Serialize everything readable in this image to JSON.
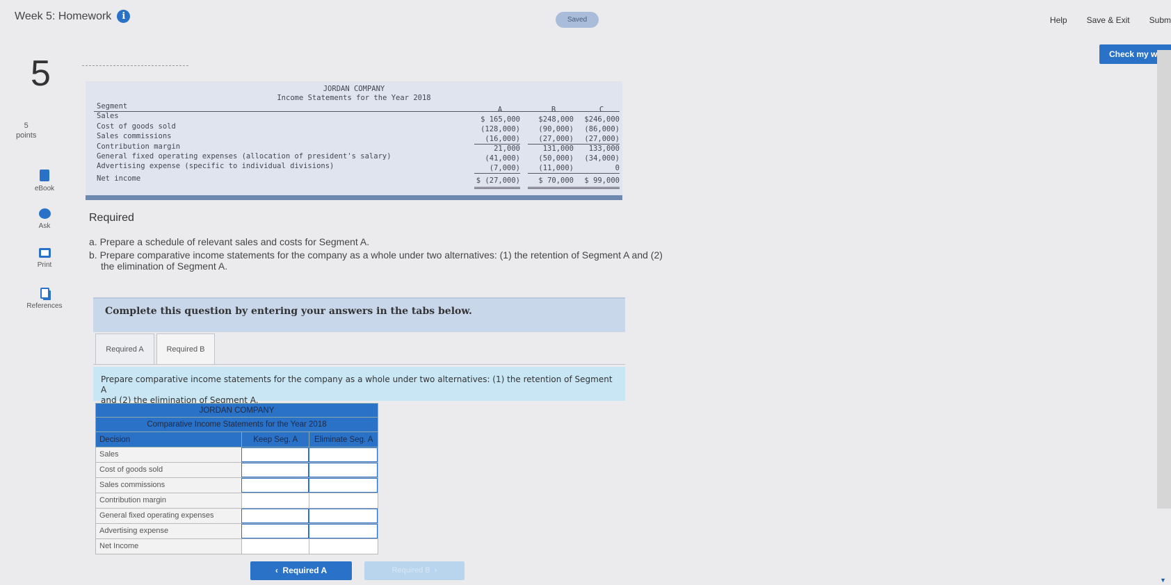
{
  "header": {
    "assignment_title": "Week 5: Homework",
    "saved_label": "Saved",
    "help": "Help",
    "save_exit": "Save & Exit",
    "submit": "Subm",
    "check_my_work": "Check my work"
  },
  "question": {
    "number": "5",
    "points_value": "5",
    "points_label": "points"
  },
  "rail": {
    "ebook": "eBook",
    "ask": "Ask",
    "print": "Print",
    "references": "References"
  },
  "statement": {
    "company": "JORDAN COMPANY",
    "subtitle": "Income Statements for the Year 2018",
    "segment_label": "Segment",
    "columns": [
      "A",
      "B",
      "C"
    ],
    "rows": [
      {
        "label": "Sales",
        "values": [
          "$ 165,000",
          "$248,000",
          "$246,000"
        ]
      },
      {
        "label": "Cost of goods sold",
        "values": [
          "(128,000)",
          "(90,000)",
          "(86,000)"
        ]
      },
      {
        "label": "Sales commissions",
        "values": [
          "(16,000)",
          "(27,000)",
          "(27,000)"
        ]
      },
      {
        "label": "Contribution margin",
        "values": [
          "21,000",
          "131,000",
          "133,000"
        ]
      },
      {
        "label": "General fixed operating expenses (allocation of president's salary)",
        "values": [
          "(41,000)",
          "(50,000)",
          "(34,000)"
        ]
      },
      {
        "label": "Advertising expense (specific to individual divisions)",
        "values": [
          "(7,000)",
          "(11,000)",
          "0"
        ]
      },
      {
        "label": "Net income",
        "values": [
          "$ (27,000)",
          "$ 70,000",
          "$ 99,000"
        ]
      }
    ]
  },
  "required": {
    "title": "Required",
    "a": "a. Prepare a schedule of relevant sales and costs for Segment A.",
    "b_line1": "b. Prepare comparative income statements for the company as a whole under two alternatives: (1) the retention of Segment A and (2)",
    "b_line2": "the elimination of Segment A."
  },
  "instructions": "Complete this question by entering your answers in the tabs below.",
  "tabs": [
    {
      "label": "Required A",
      "active": false
    },
    {
      "label": "Required B",
      "active": true
    }
  ],
  "prompt": {
    "line1": "Prepare comparative income statements for the company as a whole under two alternatives: (1) the retention of Segment A",
    "line2": "and (2) the elimination of Segment A."
  },
  "answer_table": {
    "company": "JORDAN COMPANY",
    "subtitle": "Comparative Income Statements for the Year 2018",
    "decision_label": "Decision",
    "col_keep": "Keep Seg. A",
    "col_eliminate": "Eliminate Seg. A",
    "rows": [
      "Sales",
      "Cost of goods sold",
      "Sales commissions",
      "Contribution margin",
      "General fixed operating expenses",
      "Advertising expense",
      "Net Income"
    ]
  },
  "nav": {
    "prev_label": "Required A",
    "next_label": "Required B"
  }
}
